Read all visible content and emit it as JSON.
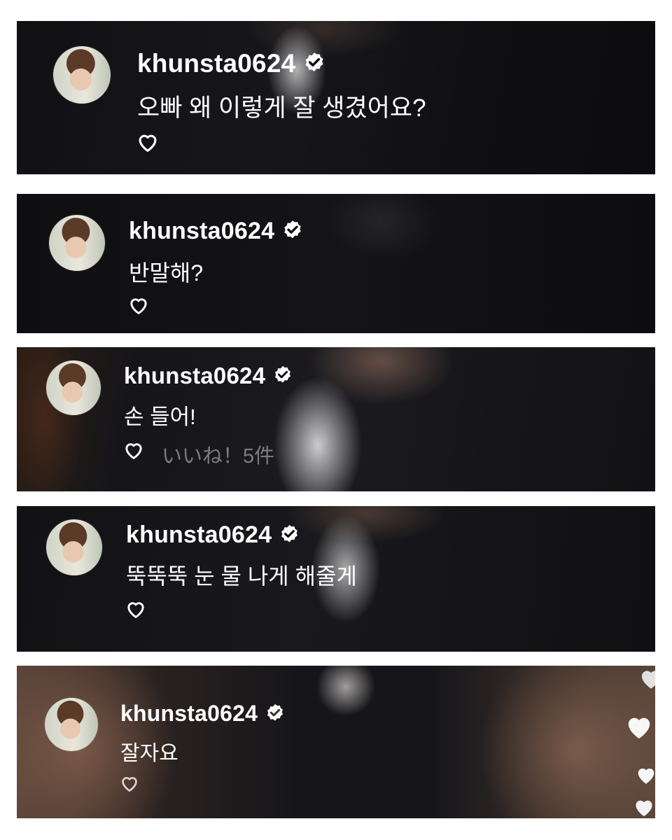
{
  "comments": [
    {
      "username": "khunsta0624",
      "text": "오빠 왜 이렇게 잘 생겼어요?",
      "likes": ""
    },
    {
      "username": "khunsta0624",
      "text": "반말해?",
      "likes": ""
    },
    {
      "username": "khunsta0624",
      "text": "손 들어!",
      "likes": "いいね！5件"
    },
    {
      "username": "khunsta0624",
      "text": "뚝뚝뚝 눈 물 나게 해줄게",
      "likes": ""
    },
    {
      "username": "khunsta0624",
      "text": "잘자요",
      "likes": ""
    }
  ],
  "icons": {
    "verified": "verified-badge-icon",
    "like": "heart-outline-icon",
    "floating": "heart-filled-icon"
  },
  "colors": {
    "text": "#ffffff",
    "likes_text": "#7b7b80",
    "page_background": "#ffffff"
  }
}
